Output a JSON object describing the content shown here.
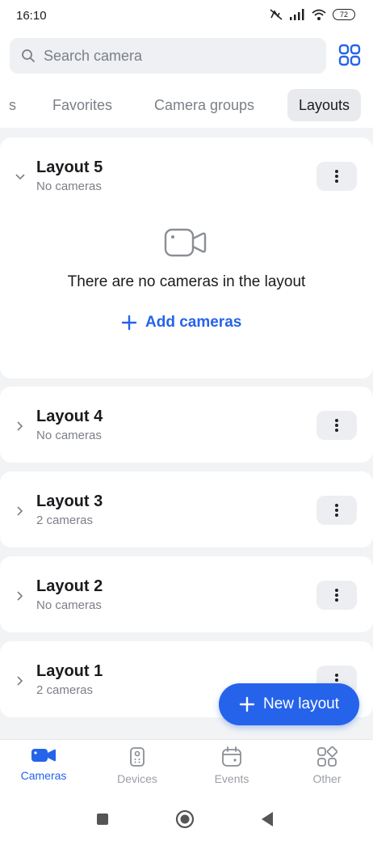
{
  "status_bar": {
    "time": "16:10",
    "battery": "72"
  },
  "search": {
    "placeholder": "Search camera"
  },
  "tabs": [
    {
      "label": "s"
    },
    {
      "label": "Favorites"
    },
    {
      "label": "Camera groups"
    },
    {
      "label": "Layouts",
      "active": true
    }
  ],
  "layouts": [
    {
      "title": "Layout 5",
      "subtitle": "No cameras",
      "expanded": true
    },
    {
      "title": "Layout 4",
      "subtitle": "No cameras"
    },
    {
      "title": "Layout 3",
      "subtitle": "2 cameras"
    },
    {
      "title": "Layout 2",
      "subtitle": "No cameras"
    },
    {
      "title": "Layout 1",
      "subtitle": "2 cameras"
    }
  ],
  "empty_state": {
    "message": "There are no cameras in the layout",
    "add_label": "Add cameras"
  },
  "fab": {
    "label": "New layout"
  },
  "bottom_nav": [
    {
      "label": "Cameras",
      "icon": "camera-icon",
      "active": true
    },
    {
      "label": "Devices",
      "icon": "device-icon"
    },
    {
      "label": "Events",
      "icon": "calendar-icon"
    },
    {
      "label": "Other",
      "icon": "other-icon"
    }
  ],
  "colors": {
    "accent": "#2563eb",
    "background": "#f2f3f5",
    "card": "#ffffff",
    "muted_text": "#7b7f86"
  }
}
